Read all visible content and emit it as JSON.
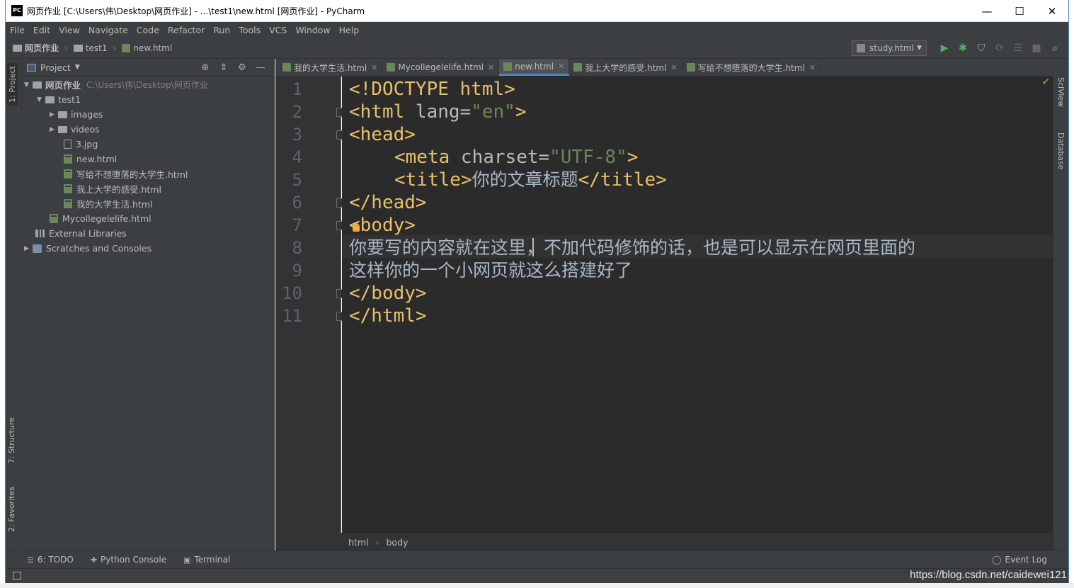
{
  "window": {
    "app_icon": "PC",
    "title": "网页作业 [C:\\Users\\伟\\Desktop\\网页作业] - ...\\test1\\new.html [网页作业] - PyCharm",
    "minimize": "—",
    "maximize": "☐",
    "close": "✕"
  },
  "menu": [
    "File",
    "Edit",
    "View",
    "Navigate",
    "Code",
    "Refactor",
    "Run",
    "Tools",
    "VCS",
    "Window",
    "Help"
  ],
  "navbar": {
    "crumbs": [
      "网页作业",
      "test1",
      "new.html"
    ],
    "run_config": "study.html"
  },
  "sidebars": {
    "left_tabs": [
      "1: Project",
      "7: Structure",
      "2: Favorites"
    ],
    "right_tabs": [
      "SciView",
      "Database"
    ]
  },
  "project_panel": {
    "title": "Project",
    "tree": [
      {
        "name": "网页作业",
        "path": "C:\\Users\\伟\\Desktop\\网页作业"
      },
      {
        "name": "test1"
      },
      {
        "name": "images"
      },
      {
        "name": "videos"
      },
      {
        "name": "3.jpg"
      },
      {
        "name": "new.html"
      },
      {
        "name": "写给不想堕落的大学生.html"
      },
      {
        "name": "我上大学的感受.html"
      },
      {
        "name": "我的大学生活.html"
      },
      {
        "name": "Mycollegelelife.html"
      },
      {
        "name": "External Libraries"
      },
      {
        "name": "Scratches and Consoles"
      }
    ]
  },
  "editor_tabs": [
    "我的大学生活.html",
    "Mycollegelelife.html",
    "new.html",
    "我上大学的感受.html",
    "写给不想堕落的大学生.html"
  ],
  "editor": {
    "line_numbers": [
      "1",
      "2",
      "3",
      "4",
      "5",
      "6",
      "7",
      "8",
      "9",
      "10",
      "11"
    ],
    "lines": {
      "l1": {
        "tag": "<!DOCTYPE html>"
      },
      "l2": {
        "open": "<html ",
        "attr": "lang=",
        "str": "\"en\"",
        "close": ">"
      },
      "l3": {
        "tag": "<head>"
      },
      "l4": {
        "open": "<meta ",
        "attr": "charset=",
        "str": "\"UTF-8\"",
        "close": ">"
      },
      "l5": {
        "open": "<title>",
        "text": "你的文章标题",
        "close": "</title>"
      },
      "l6": {
        "tag": "</head>"
      },
      "l7": {
        "tag": "<body>"
      },
      "l8": {
        "text": "你要写的内容就在这里，不加代码修饰的话，也是可以显示在网页里面的"
      },
      "l9": {
        "text": "这样你的一个小网页就这么搭建好了"
      },
      "l10": {
        "tag": "</body>"
      },
      "l11": {
        "tag": "</html>"
      }
    }
  },
  "breadcrumb": [
    "html",
    "body"
  ],
  "bottom_tools": [
    "6: TODO",
    "Python Console",
    "Terminal"
  ],
  "event_log": "Event Log",
  "watermark": "https://blog.csdn.net/caidewei121"
}
